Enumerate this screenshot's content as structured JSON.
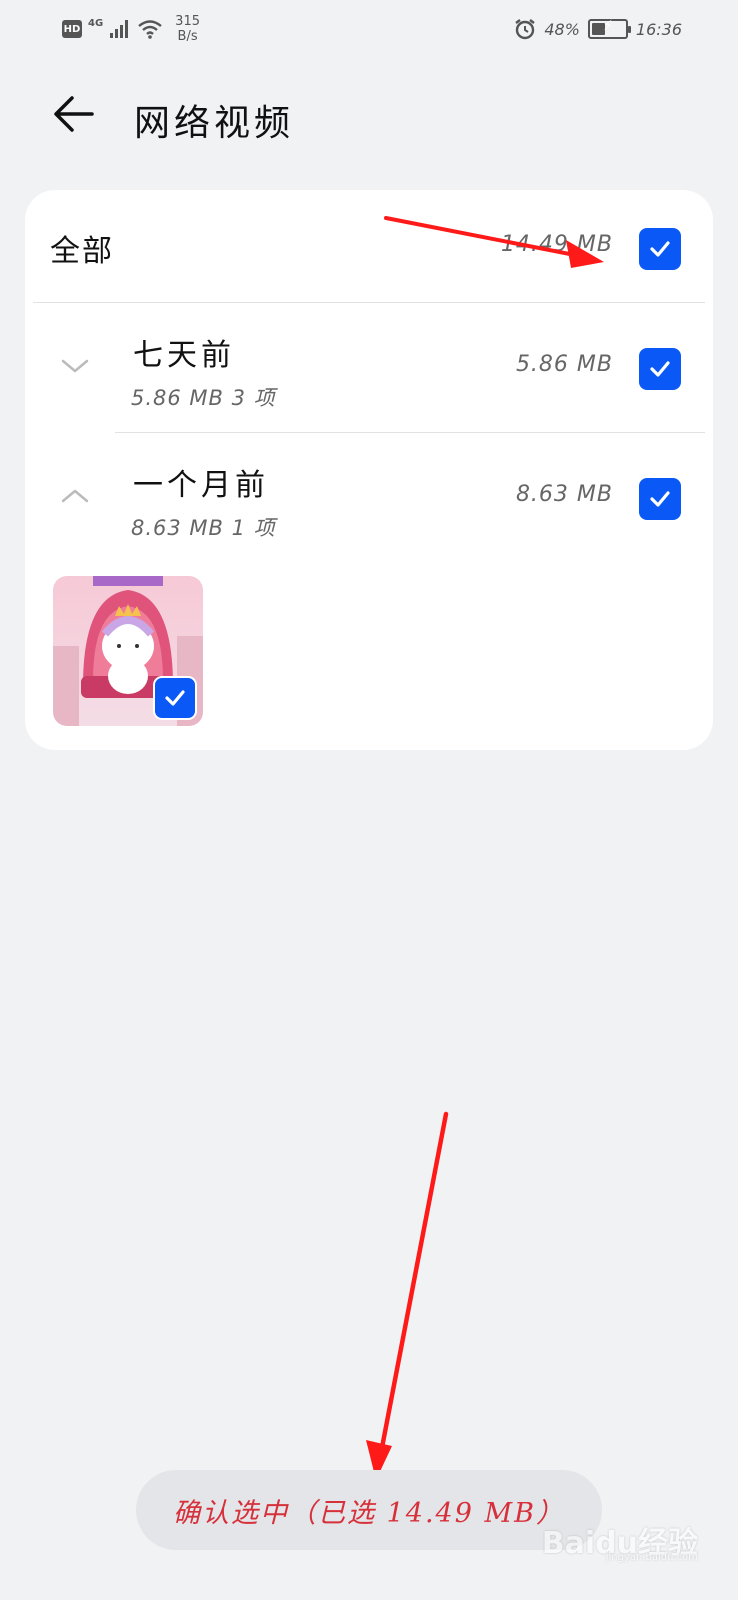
{
  "status_bar": {
    "hd": "HD",
    "network": "4G",
    "speed_value": "315",
    "speed_unit": "B/s",
    "battery_percent": "48%",
    "battery_level": 0.48,
    "time": "16:36",
    "icons": [
      "hd-icon",
      "signal-icon",
      "wifi-icon",
      "alarm-icon",
      "battery-charging-icon"
    ]
  },
  "header": {
    "title": "网络视频",
    "back_icon": "back-arrow-icon"
  },
  "list": {
    "all": {
      "label": "全部",
      "size": "14.49 MB",
      "checked": true
    },
    "groups": [
      {
        "label": "七天前",
        "summary": "5.86 MB 3 项",
        "size": "5.86 MB",
        "expanded": false,
        "checked": true
      },
      {
        "label": "一个月前",
        "summary": "8.63 MB 1 项",
        "size": "8.63 MB",
        "expanded": true,
        "checked": true
      }
    ],
    "thumbnail": {
      "checked": true
    }
  },
  "footer": {
    "confirm_label": "确认选中（已选 14.49 MB）"
  },
  "watermark": {
    "text": "Baidu经验",
    "sub": "jingyan.baidu.com"
  },
  "colors": {
    "accent": "#0a59f7",
    "background": "#f1f2f4",
    "confirm_text": "#d6303a",
    "annotation_arrow": "#ff1a1a"
  }
}
